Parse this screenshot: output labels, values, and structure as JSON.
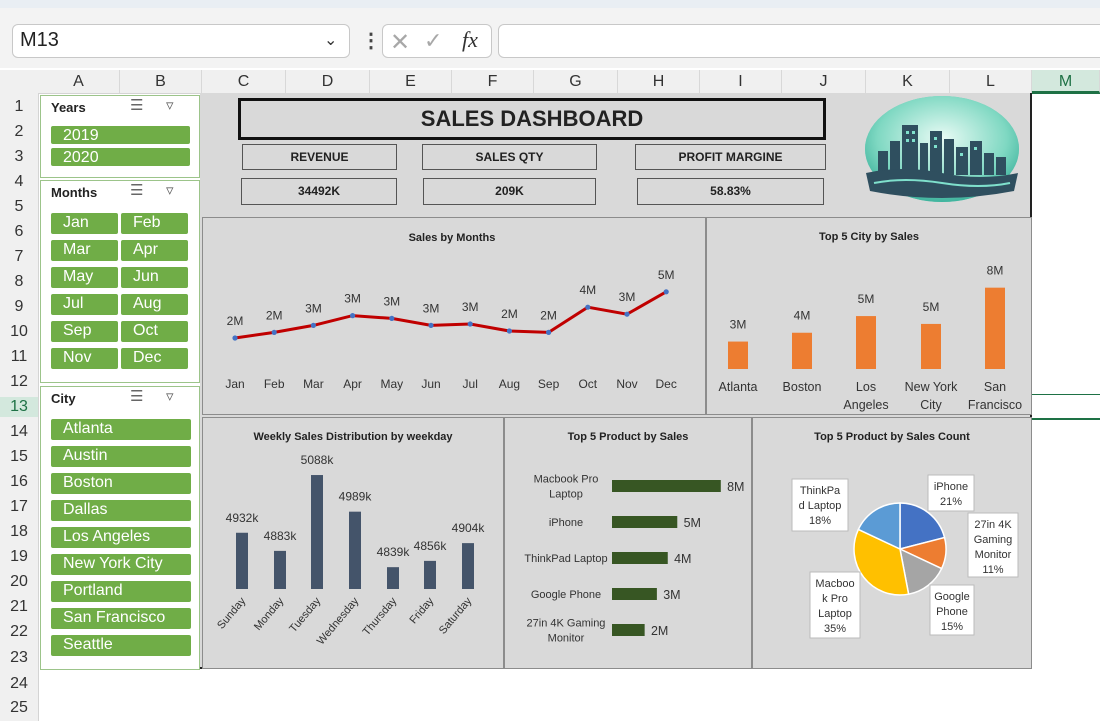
{
  "app": {
    "name_box": "M13",
    "formula": ""
  },
  "columns": [
    "A",
    "B",
    "C",
    "D",
    "E",
    "F",
    "G",
    "H",
    "I",
    "J",
    "K",
    "L",
    "M"
  ],
  "rows": [
    "1",
    "2",
    "3",
    "4",
    "5",
    "6",
    "7",
    "8",
    "9",
    "10",
    "11",
    "12",
    "13",
    "14",
    "15",
    "16",
    "17",
    "18",
    "19",
    "20",
    "21",
    "22",
    "23",
    "24",
    "25"
  ],
  "slicers": {
    "years": {
      "title": "Years",
      "items": [
        "2019",
        "2020"
      ]
    },
    "months": {
      "title": "Months",
      "items": [
        "Jan",
        "Feb",
        "Mar",
        "Apr",
        "May",
        "Jun",
        "Jul",
        "Aug",
        "Sep",
        "Oct",
        "Nov",
        "Dec"
      ]
    },
    "city": {
      "title": "City",
      "items": [
        "Atlanta",
        "Austin",
        "Boston",
        "Dallas",
        "Los Angeles",
        "New York City",
        "Portland",
        "San Francisco",
        "Seattle"
      ]
    }
  },
  "dashboard": {
    "title": "SALES DASHBOARD",
    "kpis": [
      {
        "label": "REVENUE",
        "value": "34492K"
      },
      {
        "label": "SALES QTY",
        "value": "209K"
      },
      {
        "label": "PROFIT MARGINE",
        "value": "58.83%"
      }
    ]
  },
  "colors": {
    "accent_green": "#70ad47",
    "line_red": "#c00000",
    "bar_orange": "#ed7d31",
    "bar_navy": "#44546a",
    "bar_darkgreen": "#375623",
    "selection": "#1e7145"
  },
  "chart_data": [
    {
      "type": "line",
      "title": "Sales by Months",
      "categories": [
        "Jan",
        "Feb",
        "Mar",
        "Apr",
        "May",
        "Jun",
        "Jul",
        "Aug",
        "Sep",
        "Oct",
        "Nov",
        "Dec"
      ],
      "values": [
        2.0,
        2.4,
        2.9,
        3.6,
        3.4,
        2.9,
        3.0,
        2.5,
        2.4,
        4.2,
        3.7,
        5.3
      ],
      "labels": [
        "2M",
        "2M",
        "3M",
        "3M",
        "3M",
        "3M",
        "3M",
        "2M",
        "2M",
        "4M",
        "3M",
        "5M"
      ]
    },
    {
      "type": "bar",
      "title": "Top 5 City by Sales",
      "categories": [
        "Atlanta",
        "Boston",
        "Los Angeles",
        "New York City",
        "San Francisco"
      ],
      "values": [
        2.8,
        3.7,
        5.4,
        4.6,
        8.3
      ],
      "labels": [
        "3M",
        "4M",
        "5M",
        "5M",
        "8M"
      ]
    },
    {
      "type": "bar",
      "title": "Weekly Sales Distribution by weekday",
      "categories": [
        "Sunday",
        "Monday",
        "Tuesday",
        "Wednesday",
        "Thursday",
        "Friday",
        "Saturday"
      ],
      "values": [
        4932,
        4883,
        5088,
        4989,
        4839,
        4856,
        4904
      ],
      "labels": [
        "4932k",
        "4883k",
        "5088k",
        "4989k",
        "4839k",
        "4856k",
        "4904k"
      ]
    },
    {
      "type": "bar",
      "title": "Top 5 Product by Sales",
      "categories": [
        "Macbook Pro Laptop",
        "iPhone",
        "ThinkPad Laptop",
        "Google Phone",
        "27in 4K Gaming Monitor"
      ],
      "values": [
        8.0,
        4.8,
        4.1,
        3.3,
        2.4
      ],
      "labels": [
        "8M",
        "5M",
        "4M",
        "3M",
        "2M"
      ]
    },
    {
      "type": "pie",
      "title": "Top 5 Product by Sales Count",
      "categories": [
        "iPhone",
        "27in 4K Gaming Monitor",
        "Google Phone",
        "Macbook Pro Laptop",
        "ThinkPad Laptop"
      ],
      "values": [
        21,
        11,
        15,
        35,
        18
      ],
      "labels": [
        "21%",
        "11%",
        "15%",
        "35%",
        "18%"
      ],
      "colors": [
        "#4472c4",
        "#ed7d31",
        "#a5a5a5",
        "#ffc000",
        "#5b9bd5"
      ]
    }
  ]
}
